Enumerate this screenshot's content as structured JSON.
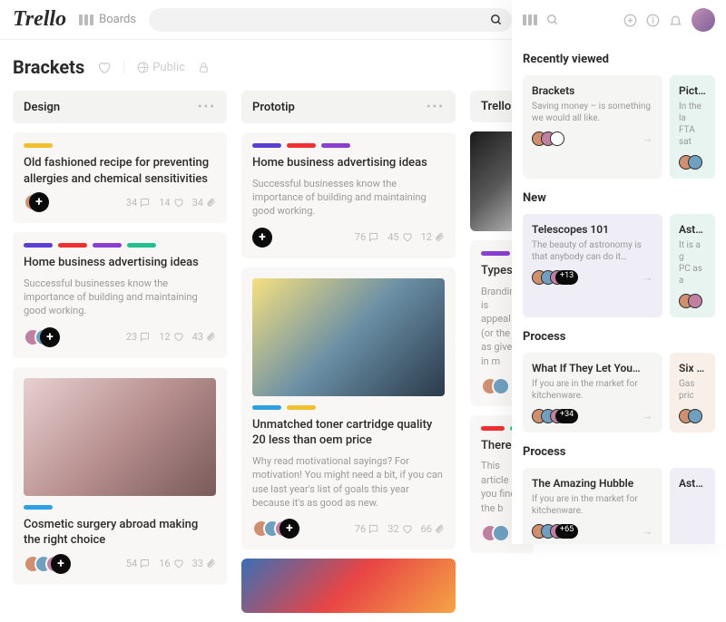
{
  "app": {
    "logo": "Trello",
    "boards_label": "Boards"
  },
  "board": {
    "title": "Brackets",
    "visibility": "Public"
  },
  "lists": [
    {
      "title": "Design"
    },
    {
      "title": "Prototip"
    },
    {
      "title": "Trello"
    }
  ],
  "cards": {
    "design": [
      {
        "labels": [
          "#f0c030"
        ],
        "title": "Old fashioned recipe for preventing allergies and chemical sensitivities",
        "stats": {
          "comments": "34",
          "likes": "14",
          "attach": "34"
        }
      },
      {
        "labels": [
          "#5a3fd0",
          "#f03030",
          "#8a3fd0",
          "#20c090"
        ],
        "title": "Home business advertising ideas",
        "desc": "Successful businesses know the importance of building and maintaining good working.",
        "stats": {
          "comments": "23",
          "likes": "12",
          "attach": "43"
        }
      },
      {
        "labels": [
          "#30a0e0"
        ],
        "title": "Cosmetic surgery abroad making the right choice",
        "stats": {
          "comments": "54",
          "likes": "16",
          "attach": "33"
        }
      }
    ],
    "prototip": [
      {
        "labels": [
          "#5a3fd0",
          "#f03030",
          "#8a3fd0"
        ],
        "title": "Home business advertising ideas",
        "desc": "Successful businesses know the importance of building and maintaining good working.",
        "stats": {
          "comments": "76",
          "likes": "45",
          "attach": "12"
        }
      },
      {
        "labels": [
          "#30a0e0",
          "#f0c030"
        ],
        "title": "Unmatched toner cartridge quality 20 less than oem price",
        "desc": "Why read motivational sayings? For motivation! You might need a bit, if you can use last year's list of goals this year because it's as good as new.",
        "stats": {
          "comments": "76",
          "likes": "32",
          "attach": "66"
        }
      }
    ],
    "trello": [
      {
        "labels": [
          "#8a3fd0"
        ],
        "title": "Types of p",
        "desc": "Branding is\nappeal (or the\nas given in m"
      },
      {
        "labels": [
          "#f03030",
          "#20c090"
        ],
        "title": "There is no",
        "desc": "This article is\nyou find the b"
      }
    ]
  },
  "sidebar": {
    "sections": [
      {
        "heading": "Recently viewed",
        "cards": [
          {
            "bg": "gray",
            "title": "Brackets",
            "desc": "Saving money – is something we would all like."
          },
          {
            "bg": "mint",
            "title": "Picture",
            "desc": "In the la\nFTA sat"
          }
        ]
      },
      {
        "heading": "New",
        "cards": [
          {
            "bg": "lav",
            "title": "Telescopes 101",
            "desc": "The beauty of astronomy is that anybody can do it…",
            "count": "+13"
          },
          {
            "bg": "mint",
            "title": "Asteroi",
            "desc": "It is a g\nPC as a"
          }
        ]
      },
      {
        "heading": "Process",
        "cards": [
          {
            "bg": "gray",
            "title": "What If They Let You…",
            "desc": "If you are in the market for kitchenware.",
            "count": "+34"
          },
          {
            "bg": "peach",
            "title": "Six Pac",
            "desc": "Gas pric"
          }
        ]
      },
      {
        "heading": "Process",
        "cards": [
          {
            "bg": "gray",
            "title": "The Amazing Hubble",
            "desc": "If you are in the market for kitchenware.",
            "count": "+65"
          },
          {
            "bg": "lav",
            "title": "Astron",
            "desc": ""
          }
        ]
      }
    ]
  }
}
